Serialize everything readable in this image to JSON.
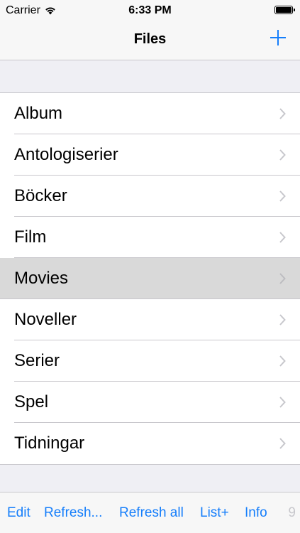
{
  "status_bar": {
    "carrier": "Carrier",
    "time": "6:33 PM",
    "battery_level": 1.0
  },
  "nav": {
    "title": "Files",
    "add_icon": "plus-icon"
  },
  "list": {
    "items": [
      {
        "label": "Album",
        "selected": false
      },
      {
        "label": "Antologiserier",
        "selected": false
      },
      {
        "label": "Böcker",
        "selected": false
      },
      {
        "label": "Film",
        "selected": false
      },
      {
        "label": "Movies",
        "selected": true
      },
      {
        "label": "Noveller",
        "selected": false
      },
      {
        "label": "Serier",
        "selected": false
      },
      {
        "label": "Spel",
        "selected": false
      },
      {
        "label": "Tidningar",
        "selected": false
      }
    ]
  },
  "toolbar": {
    "edit": "Edit",
    "refresh": "Refresh...",
    "refresh_all": "Refresh all",
    "list_plus": "List+",
    "info": "Info",
    "count": "9"
  },
  "colors": {
    "accent": "#157efb",
    "selected_row": "#d9d9d9",
    "background": "#efeff4"
  }
}
